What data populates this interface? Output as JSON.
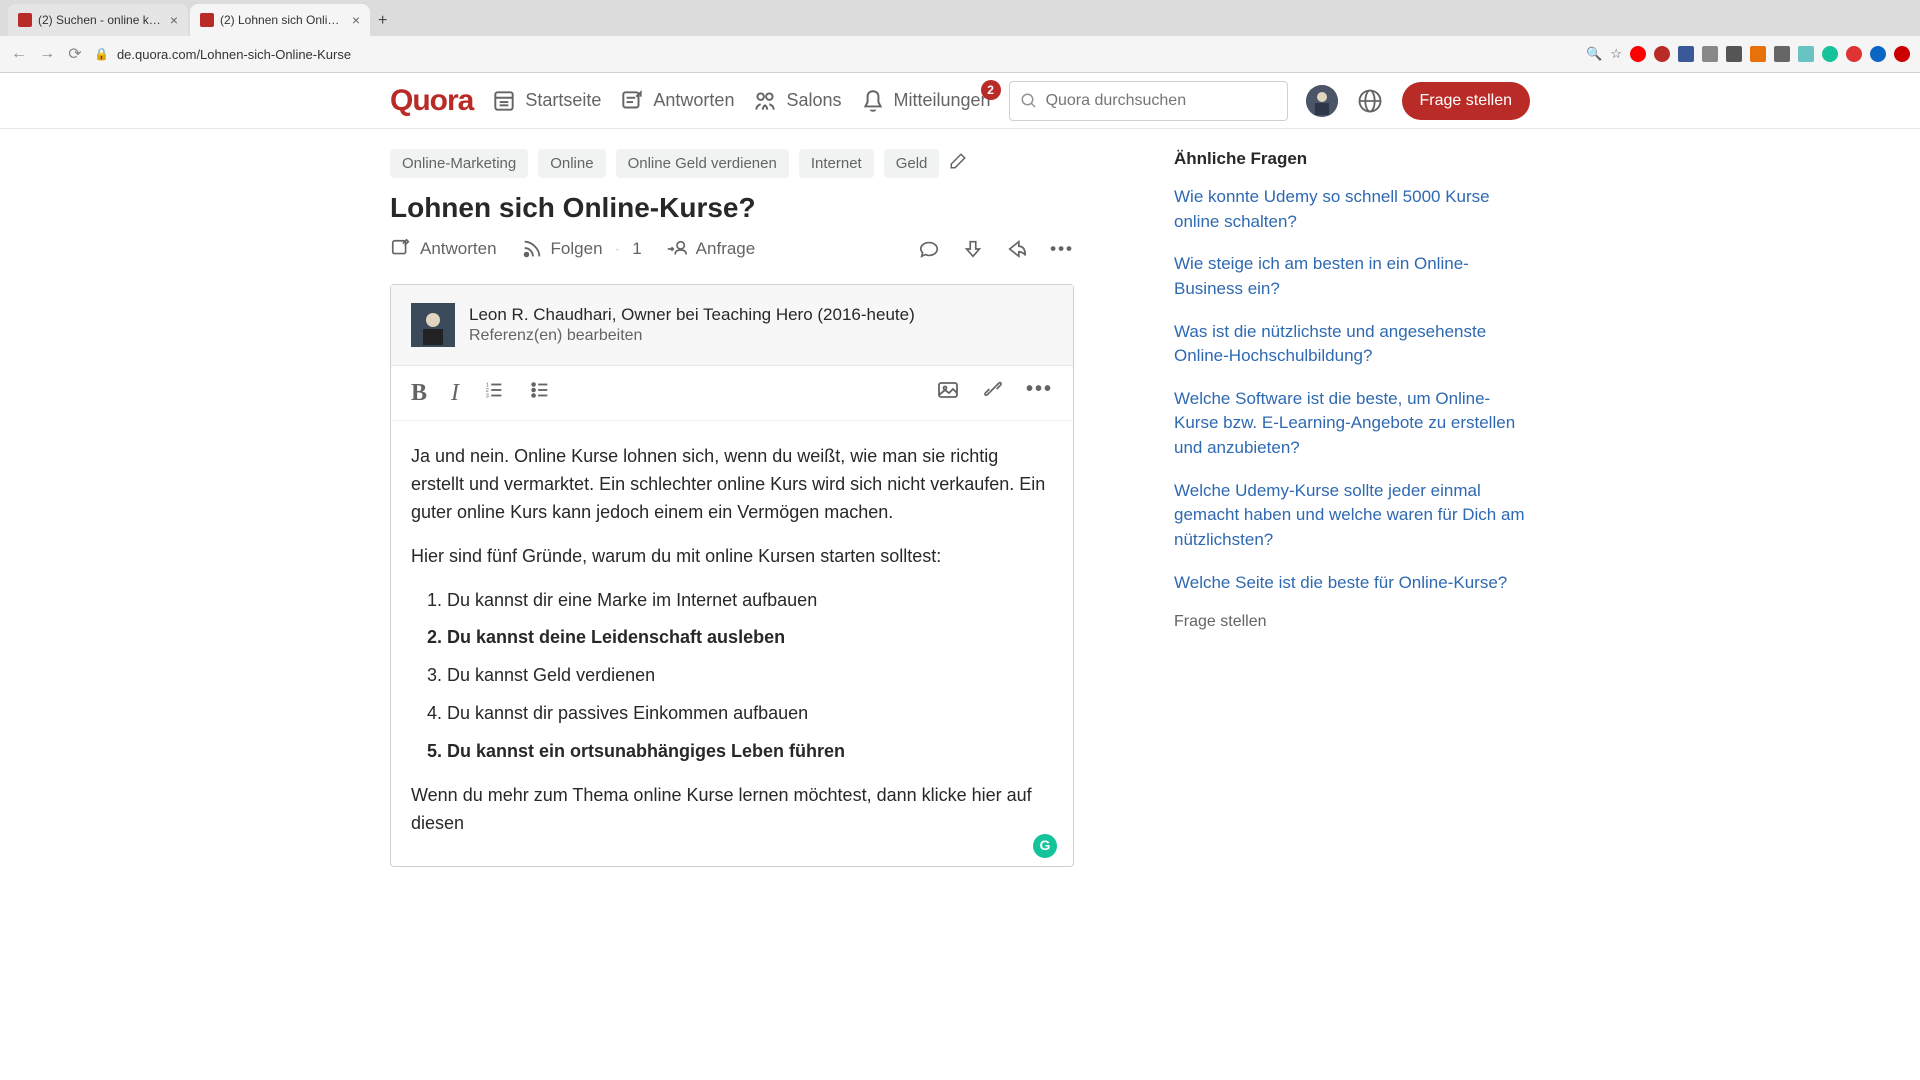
{
  "browser": {
    "tabs": [
      {
        "title": "(2) Suchen - online kurse - Q",
        "active": false
      },
      {
        "title": "(2) Lohnen sich Online-Kurse?",
        "active": true
      }
    ],
    "url": "de.quora.com/Lohnen-sich-Online-Kurse"
  },
  "header": {
    "logo": "Quora",
    "nav": {
      "home": "Startseite",
      "answer": "Antworten",
      "spaces": "Salons",
      "notifications": "Mitteilungen",
      "notif_count": "2"
    },
    "search_placeholder": "Quora durchsuchen",
    "ask": "Frage stellen"
  },
  "tags": [
    "Online-Marketing",
    "Online",
    "Online Geld verdienen",
    "Internet",
    "Geld"
  ],
  "question": "Lohnen sich Online-Kurse?",
  "actions": {
    "answer": "Antworten",
    "follow": "Folgen",
    "follow_count": "1",
    "request": "Anfrage"
  },
  "answer": {
    "author": "Leon R. Chaudhari, Owner bei Teaching Hero (2016-heute)",
    "edit_refs": "Referenz(en) bearbeiten",
    "p1": "Ja und nein. Online Kurse lohnen sich, wenn du weißt, wie man sie richtig erstellt und vermarktet. Ein schlechter online Kurs wird sich nicht verkaufen. Ein guter online Kurs kann jedoch einem ein Vermögen machen.",
    "p2": "Hier sind fünf Gründe, warum du mit online Kursen starten solltest:",
    "list": [
      {
        "text": "Du kannst dir eine Marke im Internet aufbauen",
        "bold": false
      },
      {
        "text": "Du kannst deine Leidenschaft ausleben",
        "bold": true
      },
      {
        "text": "Du kannst Geld verdienen",
        "bold": false
      },
      {
        "text": "Du kannst dir passives Einkommen aufbauen",
        "bold": false
      },
      {
        "text": "Du kannst ein ortsunabhängiges Leben führen",
        "bold": true
      }
    ],
    "p3": "Wenn du mehr zum Thema online Kurse lernen möchtest, dann klicke hier auf diesen"
  },
  "sidebar": {
    "title": "Ähnliche Fragen",
    "links": [
      "Wie konnte Udemy so schnell 5000 Kurse online schalten?",
      "Wie steige ich am besten in ein Online-Business ein?",
      "Was ist die nützlichste und angesehenste Online-Hochschulbildung?",
      "Welche Software ist die beste, um Online-Kurse bzw. E-Learning-Angebote zu erstellen und anzubieten?",
      "Welche Udemy-Kurse sollte jeder einmal gemacht haben und welche waren für Dich am nützlichsten?",
      "Welche Seite ist die beste für Online-Kurse?"
    ],
    "ask": "Frage stellen"
  }
}
